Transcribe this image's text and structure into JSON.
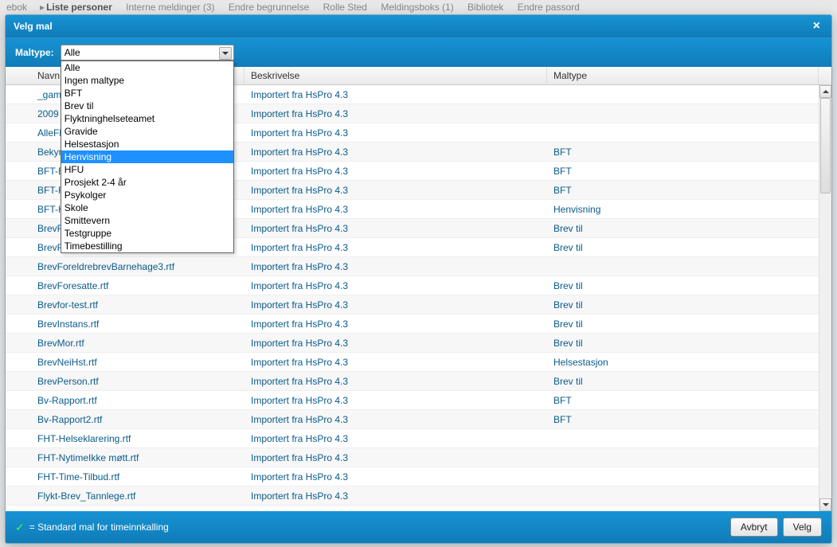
{
  "bgNav": {
    "crumbPrefix": "ebok",
    "crumbActive": "Liste personer",
    "items": [
      "Interne meldinger (3)",
      "Endre begrunnelse",
      "Rolle Sted",
      "Meldingsboks (1)",
      "Bibliotek",
      "Endre passord"
    ]
  },
  "modal": {
    "title": "Velg mal",
    "filterLabel": "Maltype:",
    "selected": "Alle",
    "options": [
      "Alle",
      "Ingen maltype",
      "BFT",
      "Brev til",
      "Flyktninghelseteamet",
      "Gravide",
      "Helsestasjon",
      "Henvisning",
      "HFU",
      "Prosjekt 2-4 år",
      "Psykolger",
      "Skole",
      "Smittevern",
      "Testgruppe",
      "Timebestilling"
    ],
    "highlightIndex": 7
  },
  "columns": {
    "name": "Navn",
    "desc": "Beskrivelse",
    "type": "Maltype"
  },
  "rows": [
    {
      "name": "_gamm",
      "desc": "Importert fra HsPro 4.3",
      "type": ""
    },
    {
      "name": "2009",
      "desc": "Importert fra HsPro 4.3",
      "type": ""
    },
    {
      "name": "AlleFle",
      "desc": "Importert fra HsPro 4.3",
      "type": ""
    },
    {
      "name": "Bekym",
      "desc": "Importert fra HsPro 4.3",
      "type": "BFT"
    },
    {
      "name": "BFT-Br",
      "desc": "Importert fra HsPro 4.3",
      "type": "BFT"
    },
    {
      "name": "BFT-Fa",
      "desc": "Importert fra HsPro 4.3",
      "type": "BFT"
    },
    {
      "name": "BFT-He",
      "desc": "Importert fra HsPro 4.3",
      "type": "Henvisning"
    },
    {
      "name": "BrevFar.rtf",
      "desc": "Importert fra HsPro 4.3",
      "type": "Brev til"
    },
    {
      "name": "BrevForeldrebrevBarnehage.rtf",
      "desc": "Importert fra HsPro 4.3",
      "type": "Brev til"
    },
    {
      "name": "BrevForeldrebrevBarnehage3.rtf",
      "desc": "Importert fra HsPro 4.3",
      "type": ""
    },
    {
      "name": "BrevForesatte.rtf",
      "desc": "Importert fra HsPro 4.3",
      "type": "Brev til"
    },
    {
      "name": "Brevfor-test.rtf",
      "desc": "Importert fra HsPro 4.3",
      "type": "Brev til"
    },
    {
      "name": "BrevInstans.rtf",
      "desc": "Importert fra HsPro 4.3",
      "type": "Brev til"
    },
    {
      "name": "BrevMor.rtf",
      "desc": "Importert fra HsPro 4.3",
      "type": "Brev til"
    },
    {
      "name": "BrevNeiHst.rtf",
      "desc": "Importert fra HsPro 4.3",
      "type": "Helsestasjon"
    },
    {
      "name": "BrevPerson.rtf",
      "desc": "Importert fra HsPro 4.3",
      "type": "Brev til"
    },
    {
      "name": "Bv-Rapport.rtf",
      "desc": "Importert fra HsPro 4.3",
      "type": "BFT"
    },
    {
      "name": "Bv-Rapport2.rtf",
      "desc": "Importert fra HsPro 4.3",
      "type": "BFT"
    },
    {
      "name": "FHT-Helseklarering.rtf",
      "desc": "Importert fra HsPro 4.3",
      "type": ""
    },
    {
      "name": "FHT-NytimeIkke møtt.rtf",
      "desc": "Importert fra HsPro 4.3",
      "type": ""
    },
    {
      "name": "FHT-Time-Tilbud.rtf",
      "desc": "Importert fra HsPro 4.3",
      "type": ""
    },
    {
      "name": "Flykt-Brev_Tannlege.rtf",
      "desc": "Importert fra HsPro 4.3",
      "type": ""
    }
  ],
  "footer": {
    "legend": "= Standard mal for timeinnkalling",
    "cancel": "Avbryt",
    "ok": "Velg"
  }
}
